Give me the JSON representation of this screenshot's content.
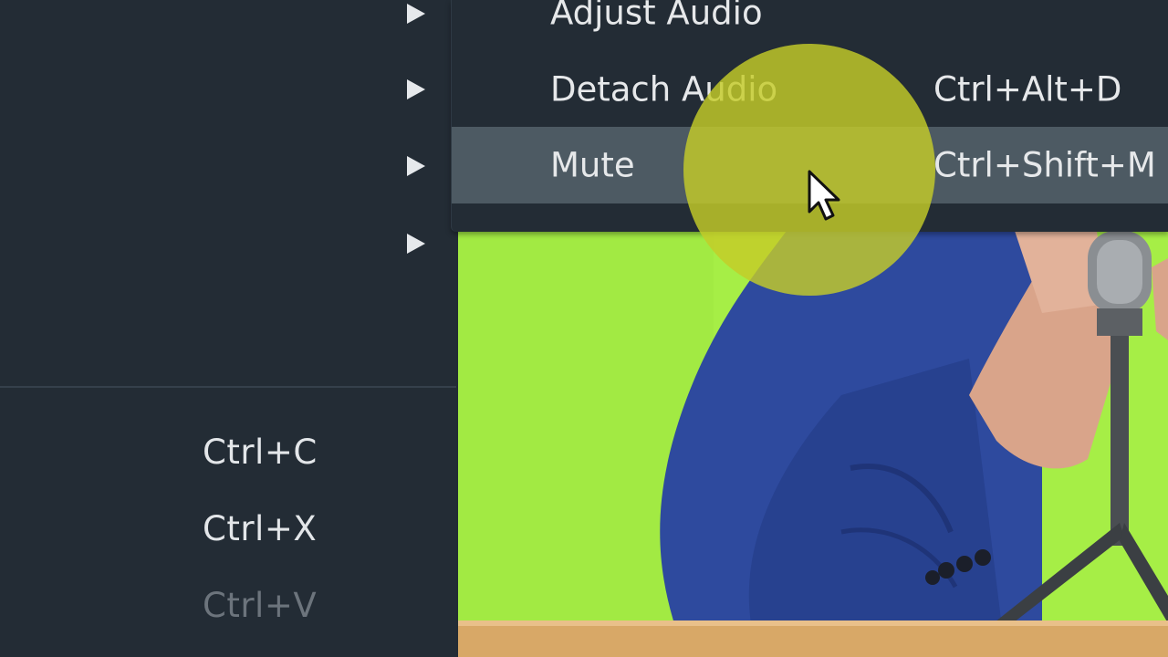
{
  "main_menu": {
    "copy_shortcut": "Ctrl+C",
    "cut_shortcut": "Ctrl+X",
    "paste_shortcut": "Ctrl+V"
  },
  "audio_submenu": {
    "items": [
      {
        "label": "Adjust Audio",
        "shortcut": ""
      },
      {
        "label": "Detach Audio",
        "shortcut": "Ctrl+Alt+D"
      },
      {
        "label": "Mute",
        "shortcut": "Ctrl+Shift+M",
        "highlighted": true
      }
    ]
  },
  "icons": [
    "submenu-arrow-icon",
    "mouse-pointer-icon"
  ],
  "colors": {
    "menu_bg": "#232c35",
    "highlight_bg": "#4d5a63",
    "text": "#e6e8ea",
    "disabled_text": "#6c747c",
    "click_highlight": "#c4cc28",
    "green_screen": "#a8ef48"
  }
}
